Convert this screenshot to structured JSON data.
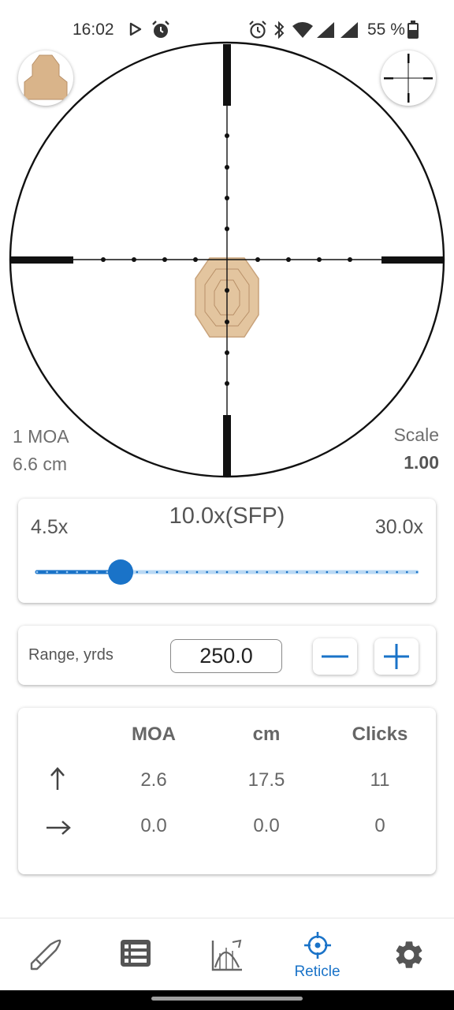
{
  "status_bar": {
    "time": "16:02",
    "battery": "55 %"
  },
  "reticle_view": {
    "moa_label": "1 MOA",
    "moa_size": "6.6 cm",
    "scale_label": "Scale",
    "scale_value": "1.00"
  },
  "zoom": {
    "min": "4.5x",
    "current": "10.0x(SFP)",
    "max": "30.0x",
    "level_fraction": 0.22
  },
  "range": {
    "label": "Range, yrds",
    "value": "250.0"
  },
  "corrections": {
    "headers": [
      "MOA",
      "cm",
      "Clicks"
    ],
    "rows": [
      {
        "direction": "up-arrow",
        "values": [
          "2.6",
          "17.5",
          "11"
        ]
      },
      {
        "direction": "right-arrow",
        "values": [
          "0.0",
          "0.0",
          "0"
        ]
      }
    ]
  },
  "nav": {
    "items": [
      {
        "icon": "bullet-icon",
        "label": ""
      },
      {
        "icon": "list-icon",
        "label": ""
      },
      {
        "icon": "trajectory-icon",
        "label": ""
      },
      {
        "icon": "crosshair-icon",
        "label": "Reticle",
        "active": true
      },
      {
        "icon": "gear-icon",
        "label": ""
      }
    ]
  },
  "colors": {
    "accent": "#1a73c8",
    "target": "#e3c59f",
    "reticle": "#111111"
  }
}
